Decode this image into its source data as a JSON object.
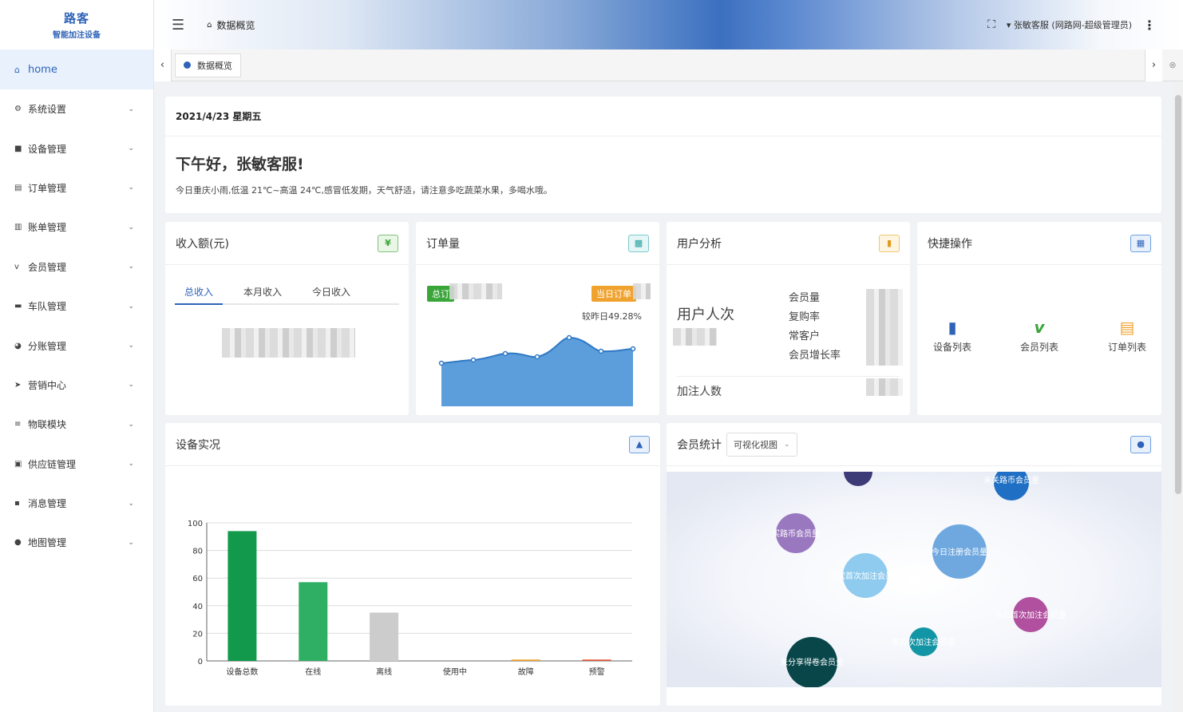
{
  "logo": {
    "mark": "路客",
    "text": "智能加注设备"
  },
  "sidebar": {
    "home": "home",
    "items": [
      {
        "label": "系统设置",
        "icon": "gear-icon"
      },
      {
        "label": "设备管理",
        "icon": "cube-icon"
      },
      {
        "label": "订单管理",
        "icon": "document-icon"
      },
      {
        "label": "账单管理",
        "icon": "bill-icon"
      },
      {
        "label": "会员管理",
        "icon": "vip-icon"
      },
      {
        "label": "车队管理",
        "icon": "car-icon"
      },
      {
        "label": "分账管理",
        "icon": "pie-icon"
      },
      {
        "label": "营销中心",
        "icon": "send-icon"
      },
      {
        "label": "物联模块",
        "icon": "sliders-icon"
      },
      {
        "label": "供应链管理",
        "icon": "lock-icon"
      },
      {
        "label": "消息管理",
        "icon": "message-icon"
      },
      {
        "label": "地图管理",
        "icon": "map-pin-icon"
      }
    ]
  },
  "header": {
    "breadcrumb": "数据概览",
    "user": "张敏客服 (网路网-超级管理员)"
  },
  "tabs": {
    "active": "数据概览"
  },
  "welcome": {
    "date": "2021/4/23 星期五",
    "greeting": "下午好，张敏客服!",
    "weather": "今日重庆小雨,低温 21℃~高温 24℃,感冒低发期，天气舒适，请注意多吃蔬菜水果，多喝水哦。"
  },
  "income": {
    "title": "收入额(元)",
    "tabs": [
      "总收入",
      "本月收入",
      "今日收入"
    ]
  },
  "orders": {
    "title": "订单量",
    "total_label": "总订",
    "today_label": "当日订单",
    "compare": "较昨日49.28%"
  },
  "users": {
    "title": "用户分析",
    "visits": "用户人次",
    "metrics": [
      "会员量",
      "复购率",
      "常客户",
      "会员增长率"
    ],
    "joins": "加注人数"
  },
  "quick": {
    "title": "快捷操作",
    "items": [
      {
        "label": "设备列表",
        "icon": "device-list-icon",
        "color": "#2f63b8"
      },
      {
        "label": "会员列表",
        "icon": "vip-list-icon",
        "color": "#3aa63a"
      },
      {
        "label": "订单列表",
        "icon": "order-list-icon",
        "color": "#f0a22e"
      }
    ]
  },
  "equipment": {
    "title": "设备实况"
  },
  "members": {
    "title": "会员统计",
    "view": "可视化视图",
    "bubbles": [
      {
        "label": "未关路币会员量",
        "color": "#1f6fc4"
      },
      {
        "label": "买路币会员量",
        "color": "#9a78c0"
      },
      {
        "label": "今日注册会员量",
        "color": "#6fa8df"
      },
      {
        "label": "完成首次加注会员量",
        "color": "#8ecbee"
      },
      {
        "label": "今日首次加注会员量",
        "color": "#b0509e"
      },
      {
        "label": "未首次加注会员量",
        "color": "#1295a5"
      },
      {
        "label": "未分享得卷会员量",
        "color": "#08464a"
      },
      {
        "label": "",
        "color": "#3d3a78"
      }
    ]
  },
  "chart_data": {
    "type": "bar",
    "categories": [
      "设备总数",
      "在线",
      "离线",
      "使用中",
      "故障",
      "预警"
    ],
    "values": [
      94,
      57,
      35,
      0,
      1,
      1
    ],
    "colors": [
      "#13994c",
      "#2faf64",
      "#cccccc",
      "#cccccc",
      "#f0a22e",
      "#e05a3a"
    ],
    "ylim": [
      0,
      100
    ],
    "yticks": [
      0,
      20,
      40,
      60,
      80,
      100
    ]
  }
}
